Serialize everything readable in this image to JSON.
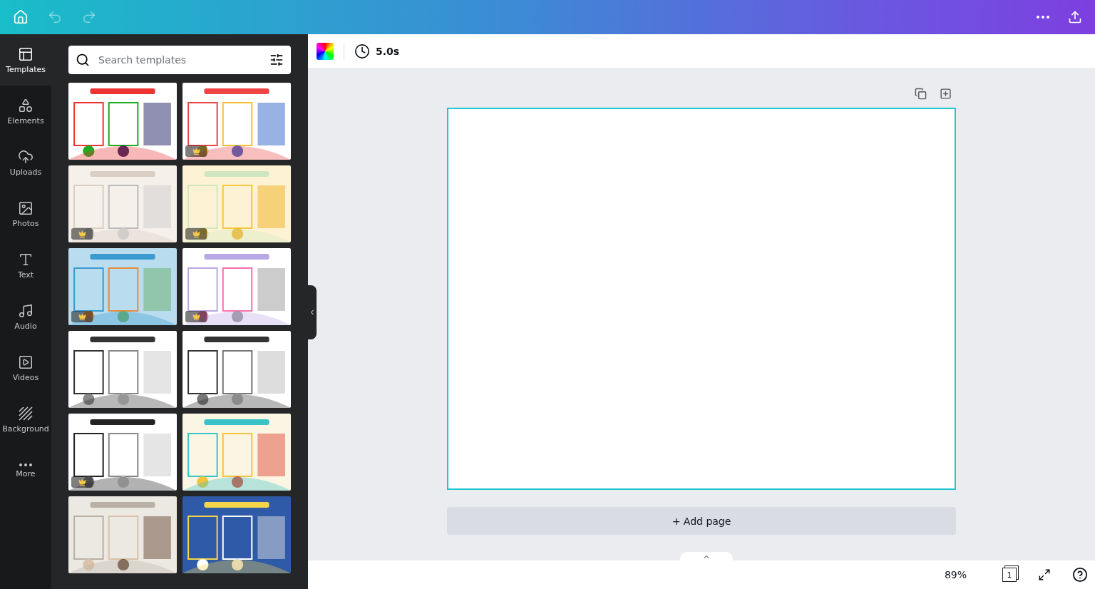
{
  "toolbar": {
    "duration": "5.0s"
  },
  "rail": [
    {
      "kind": "templates",
      "label": "Templates",
      "selected": true
    },
    {
      "kind": "elements",
      "label": "Elements",
      "selected": false
    },
    {
      "kind": "uploads",
      "label": "Uploads",
      "selected": false
    },
    {
      "kind": "photos",
      "label": "Photos",
      "selected": false
    },
    {
      "kind": "text",
      "label": "Text",
      "selected": false
    },
    {
      "kind": "audio",
      "label": "Audio",
      "selected": false
    },
    {
      "kind": "videos",
      "label": "Videos",
      "selected": false
    },
    {
      "kind": "background",
      "label": "Background",
      "selected": false
    },
    {
      "kind": "more",
      "label": "More",
      "selected": false
    }
  ],
  "search": {
    "placeholder": "Search templates"
  },
  "templates": [
    {
      "kind": "picture",
      "premium": false
    },
    {
      "kind": "picture",
      "premium": true
    },
    {
      "kind": "picture",
      "premium": true
    },
    {
      "kind": "picture",
      "premium": true
    },
    {
      "kind": "picture",
      "premium": true
    },
    {
      "kind": "picture",
      "premium": true
    },
    {
      "kind": "picture",
      "premium": false
    },
    {
      "kind": "picture",
      "premium": false
    },
    {
      "kind": "picture",
      "premium": true
    },
    {
      "kind": "picture",
      "premium": false
    },
    {
      "kind": "picture",
      "premium": false
    },
    {
      "kind": "picture",
      "premium": false
    }
  ],
  "add_page": "+ Add page",
  "status_bar": {
    "zoom": "89%",
    "page_count": "1"
  }
}
